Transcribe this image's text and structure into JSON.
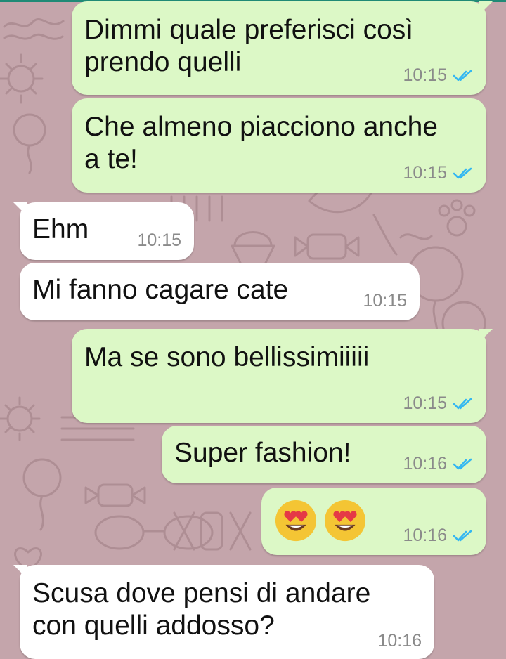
{
  "messages": [
    {
      "text": "Dimmi quale preferisci così\nprendo quelli",
      "time": "10:15",
      "direction": "outgoing",
      "status": "read"
    },
    {
      "text": "Che almeno piacciono anche\na te!",
      "time": "10:15",
      "direction": "outgoing",
      "status": "read"
    },
    {
      "text": "Ehm",
      "time": "10:15",
      "direction": "incoming"
    },
    {
      "text": "Mi fanno cagare cate",
      "time": "10:15",
      "direction": "incoming"
    },
    {
      "text": "Ma se sono bellissimiiiii",
      "time": "10:15",
      "direction": "outgoing",
      "status": "read"
    },
    {
      "text": "Super fashion!",
      "time": "10:16",
      "direction": "outgoing",
      "status": "read"
    },
    {
      "emoji": [
        "heart-eyes",
        "heart-eyes"
      ],
      "time": "10:16",
      "direction": "outgoing",
      "status": "read"
    },
    {
      "text": "Scusa dove pensi di andare\ncon quelli addosso?",
      "time": "10:16",
      "direction": "incoming"
    }
  ],
  "colors": {
    "wallpaper": "#c4a5ab",
    "outgoing_bubble": "#dcf8c6",
    "incoming_bubble": "#ffffff",
    "read_ticks": "#34b7f1",
    "timestamp": "#8a8a8a"
  },
  "wallpaper_doodles": [
    "love-doodle",
    "sun-doodle",
    "balloon-doodle",
    "xoxo-doodle",
    "heart-doodle",
    "glasses-doodle",
    "paw-doodle",
    "candy-doodle"
  ],
  "read_icon": "double-check-icon"
}
